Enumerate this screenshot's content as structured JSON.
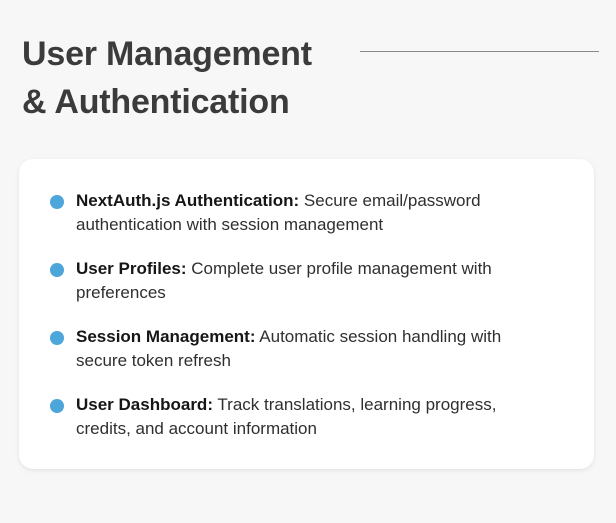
{
  "header": {
    "title_line_1": "User Management",
    "title_line_2": "& Authentication"
  },
  "features": [
    {
      "title": "NextAuth.js Authentication:",
      "description": " Secure email/password authentication with session management"
    },
    {
      "title": "User Profiles:",
      "description": " Complete user profile management with preferences"
    },
    {
      "title": "Session Management:",
      "description": " Automatic session handling with secure token refresh"
    },
    {
      "title": "User Dashboard:",
      "description": " Track translations, learning progress, credits, and account information"
    }
  ],
  "colors": {
    "background": "#f7f7f7",
    "card": "#ffffff",
    "bullet": "#4ca6d9",
    "title": "#3b3b3b"
  }
}
